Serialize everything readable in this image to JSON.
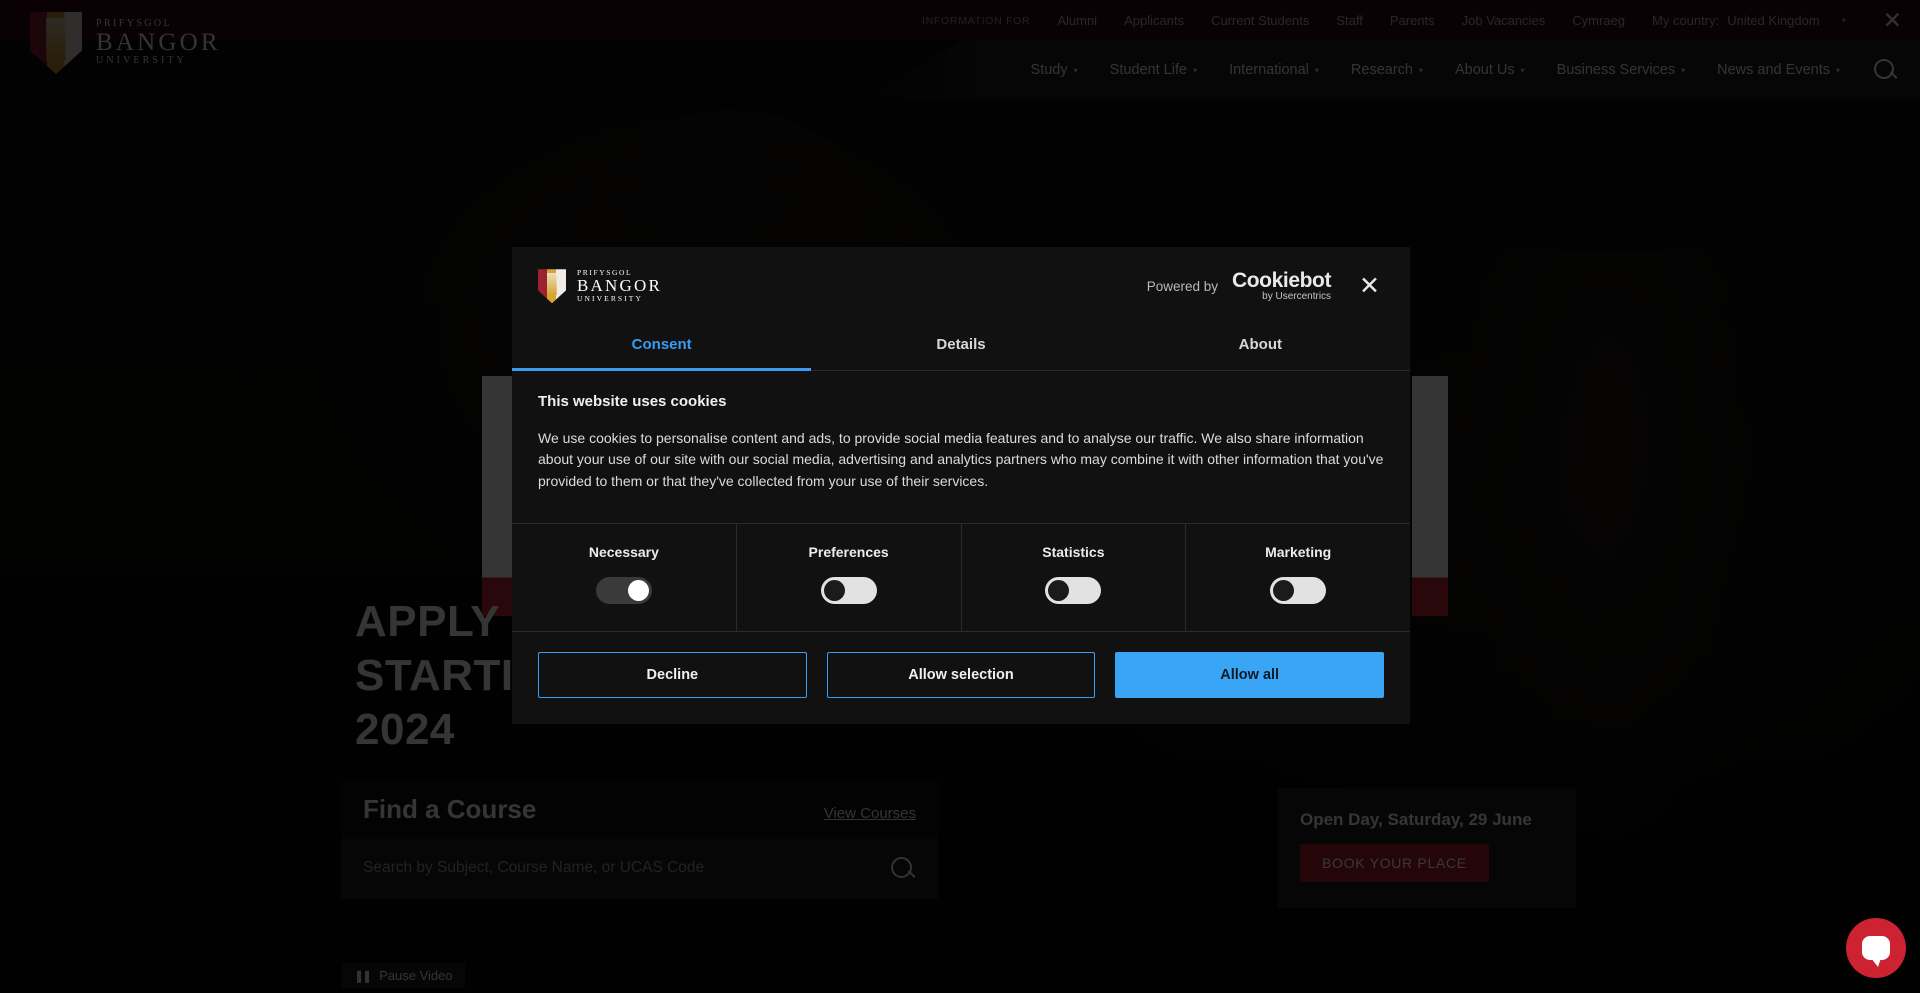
{
  "topbar": {
    "info_label": "INFORMATION FOR",
    "links": [
      "Alumni",
      "Applicants",
      "Current Students",
      "Staff",
      "Parents",
      "Job Vacancies",
      "Cymraeg"
    ],
    "country_label": "My country:",
    "country_value": "United Kingdom",
    "caret": "▾",
    "close": "✕"
  },
  "brand": {
    "line1": "PRIFYSGOL",
    "line2": "BANGOR",
    "line3": "UNIVERSITY"
  },
  "mainnav": {
    "items": [
      "Study",
      "Student Life",
      "International",
      "Research",
      "About Us",
      "Business Services",
      "News and Events"
    ],
    "caret": "▾",
    "search_icon": "search-icon"
  },
  "hero": {
    "line1": "APPLY NOW",
    "line2": "STARTING",
    "line3": "2024"
  },
  "finder": {
    "title": "Find a Course",
    "view_courses": "View Courses",
    "placeholder": "Search by Subject, Course Name, or UCAS Code",
    "value": ""
  },
  "openday": {
    "title": "Open Day, Saturday, 29 June",
    "button": "BOOK YOUR PLACE"
  },
  "video": {
    "pause_bars": "❚❚",
    "pause_label": "Pause Video"
  },
  "chat": {
    "icon": "chat-bubble-icon"
  },
  "cookie": {
    "powered_by": "Powered by",
    "cookiebot_name": "Cookiebot",
    "cookiebot_sub": "by Usercentrics",
    "close": "✕",
    "tabs": [
      {
        "label": "Consent",
        "active": true
      },
      {
        "label": "Details",
        "active": false
      },
      {
        "label": "About",
        "active": false
      }
    ],
    "heading": "This website uses cookies",
    "paragraph": "We use cookies to personalise content and ads, to provide social media features and to analyse our traffic. We also share information about your use of our site with our social media, advertising and analytics partners who may combine it with other information that you've provided to them or that they've collected from your use of their services.",
    "categories": [
      {
        "label": "Necessary",
        "state": "on"
      },
      {
        "label": "Preferences",
        "state": "off"
      },
      {
        "label": "Statistics",
        "state": "off"
      },
      {
        "label": "Marketing",
        "state": "off"
      }
    ],
    "buttons": {
      "decline": "Decline",
      "allow_selection": "Allow selection",
      "allow_all": "Allow all"
    },
    "accent": "#3aa5f5"
  }
}
